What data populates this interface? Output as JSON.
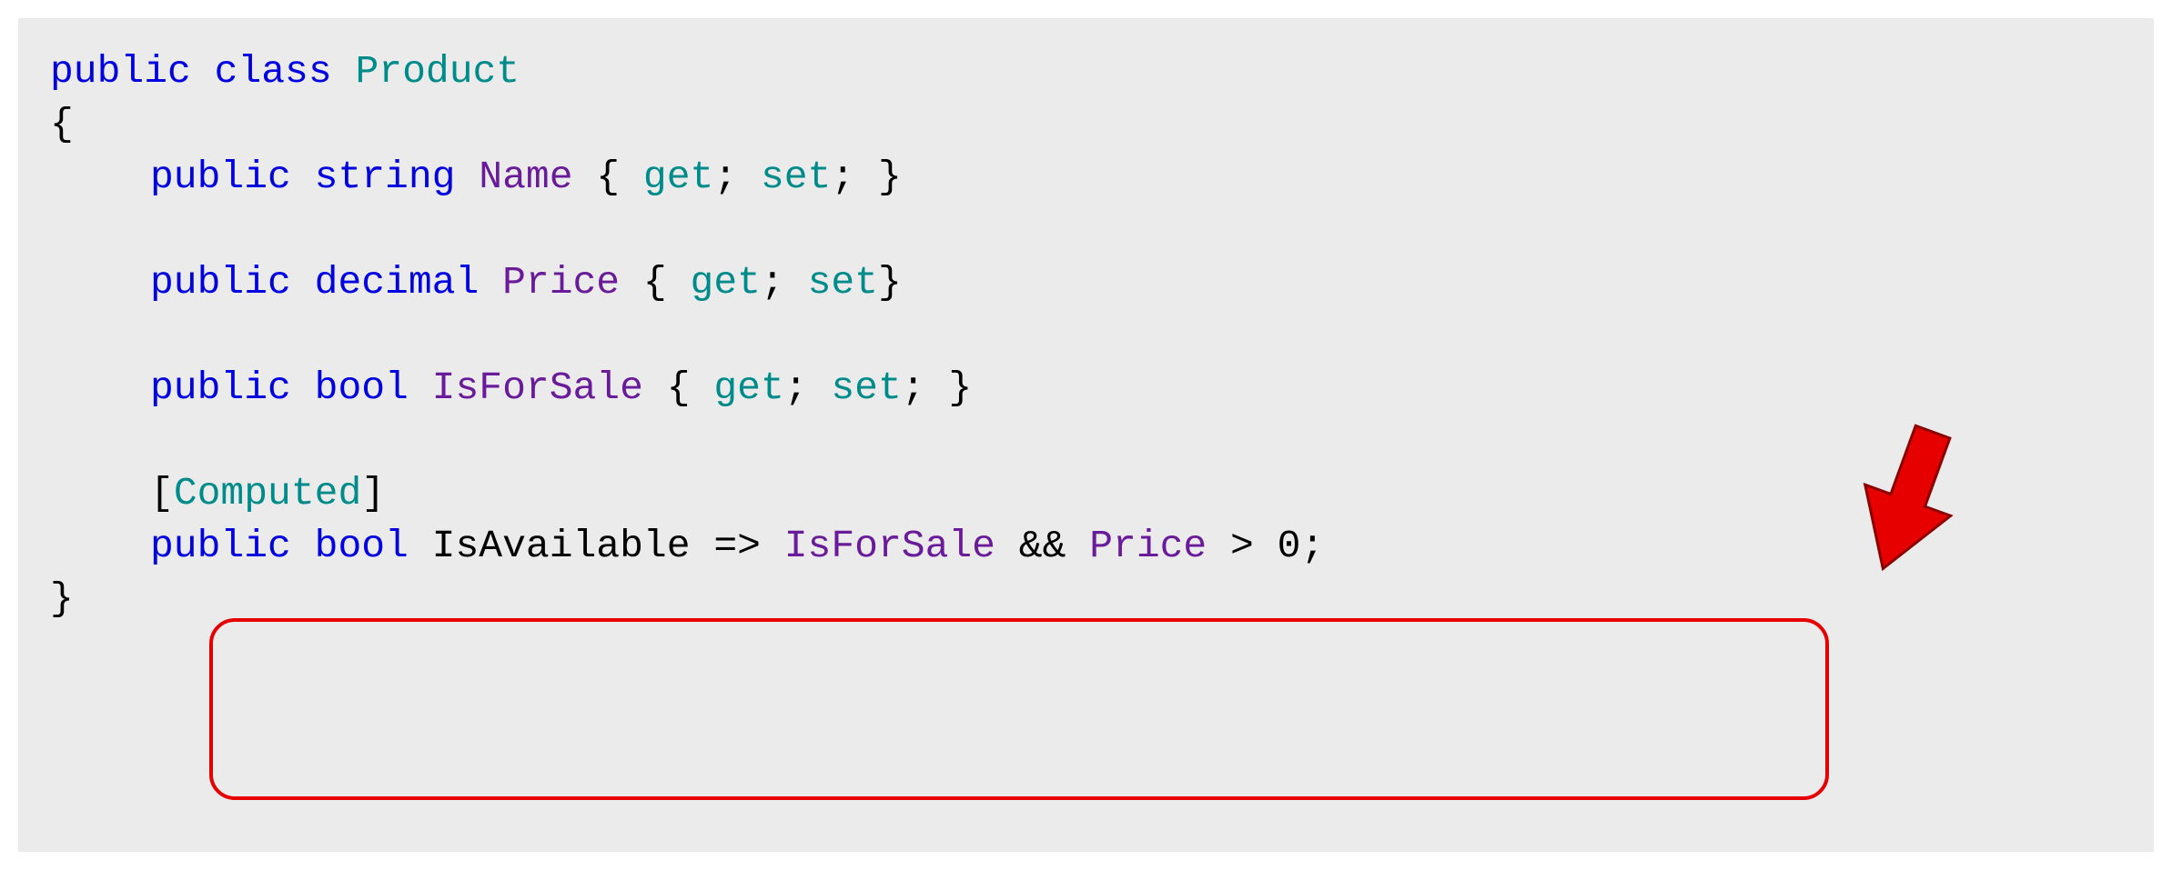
{
  "code": {
    "line1": {
      "public": "public",
      "class": "class",
      "product": "Product"
    },
    "line2": {
      "brace": "{"
    },
    "line3": {
      "public": "public",
      "string": "string",
      "name": "Name",
      "braces": " { ",
      "get": "get",
      "semi1": "; ",
      "set": "set",
      "semi2": "; }"
    },
    "line5": {
      "public": "public",
      "decimal": "decimal",
      "price": "Price",
      "braces": " { ",
      "get": "get",
      "semi1": "; ",
      "set": "set",
      "semi2": "}"
    },
    "line7": {
      "public": "public",
      "bool": "bool",
      "isforsale": "IsForSale",
      "braces": " { ",
      "get": "get",
      "semi1": "; ",
      "set": "set",
      "semi2": "; }"
    },
    "line9": {
      "bracket1": "[",
      "computed": "Computed",
      "bracket2": "]"
    },
    "line10": {
      "public": "public",
      "bool": "bool",
      "isavailable": "IsAvailable",
      "arrow": " => ",
      "isforsale": "IsForSale",
      "and": " && ",
      "price": "Price",
      "gt": " > ",
      "zero": "0",
      "semi": ";"
    },
    "line11": {
      "brace": "}"
    }
  }
}
